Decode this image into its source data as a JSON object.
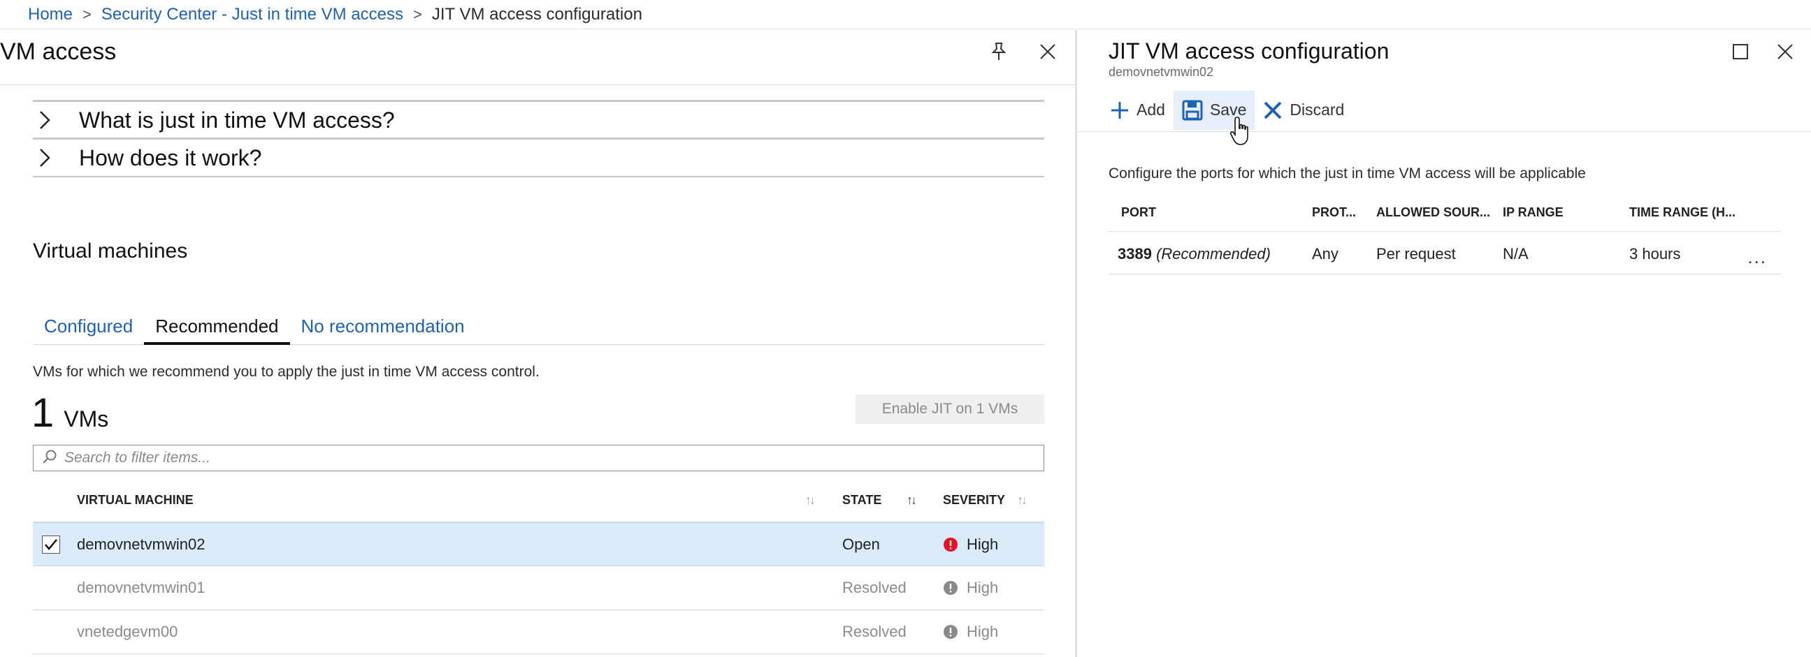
{
  "breadcrumb": {
    "items": [
      "Home",
      "Security Center - Just in time VM access"
    ],
    "current": "JIT VM access configuration"
  },
  "left_blade": {
    "title": "VM access",
    "accordions": [
      "What is just in time VM access?",
      "How does it work?"
    ],
    "section_title": "Virtual machines",
    "tabs": [
      {
        "label": "Configured",
        "active": false
      },
      {
        "label": "Recommended",
        "active": true
      },
      {
        "label": "No recommendation",
        "active": false
      }
    ],
    "description": "VMs for which we recommend you to apply the just in time VM access control.",
    "count": {
      "number": "1",
      "unit": "VMs"
    },
    "enable_button": "Enable JIT on 1 VMs",
    "search_placeholder": "Search to filter items...",
    "columns": {
      "vm": "VIRTUAL MACHINE",
      "state": "STATE",
      "severity": "SEVERITY"
    },
    "rows": [
      {
        "vm": "demovnetvmwin02",
        "state": "Open",
        "severity": "High",
        "selected": true
      },
      {
        "vm": "demovnetvmwin01",
        "state": "Resolved",
        "severity": "High",
        "selected": false
      },
      {
        "vm": "vnetedgevm00",
        "state": "Resolved",
        "severity": "High",
        "selected": false
      }
    ]
  },
  "right_blade": {
    "title": "JIT VM access configuration",
    "subtitle": "demovnetvmwin02",
    "toolbar": {
      "add": "Add",
      "save": "Save",
      "discard": "Discard"
    },
    "description": "Configure the ports for which the just in time VM access will be applicable",
    "columns": {
      "port": "PORT",
      "protocol": "PROT...",
      "allowed_source": "ALLOWED SOUR...",
      "ip_range": "IP RANGE",
      "time_range": "TIME RANGE (H..."
    },
    "port_row": {
      "port": "3389",
      "port_note": "(Recommended)",
      "protocol": "Any",
      "allowed_source": "Per request",
      "ip_range": "N/A",
      "time_range": "3 hours",
      "more": "..."
    }
  },
  "colors": {
    "link": "#1e62b4",
    "selected_row": "#dcebfb",
    "severity_high": "#e81123",
    "severity_resolved": "#8a8a8a",
    "save_icon": "#1e62b4"
  }
}
